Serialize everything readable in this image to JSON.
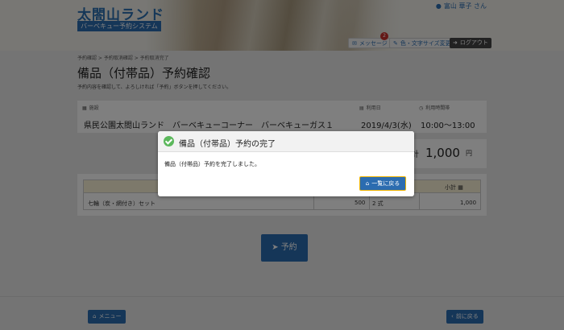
{
  "header": {
    "site_title": "太閤山ランド",
    "site_subtitle": "バーベキュー予約システム",
    "user_name": "富山 華子 さん",
    "message_label": "メッセージ",
    "message_badge": "2",
    "color_label": "色・文字サイズ変更",
    "logout_label": "ログアウト"
  },
  "breadcrumb": "予約確認 > 予約取消確認 > 予約取消完了",
  "page": {
    "title": "備品（付帯品）予約確認",
    "description": "予約内容を確認して、よろしければ「予約」ボタンを押してください。"
  },
  "info": {
    "facility_label": "施設",
    "facility_value": "県民公園太閤山ランド　バーベキューコーナー　バーベキューガス１",
    "date_label": "利用日",
    "date_value": "2019/4/3(水)",
    "time_label": "利用時間帯",
    "time_value": "10:00～13:00"
  },
  "total": {
    "prefix": "計",
    "amount": "1,000",
    "unit": "円"
  },
  "table": {
    "subtotal_header": "小計",
    "rows": [
      {
        "item": "七輪（炭・網付き）セット",
        "price": "500",
        "qty": "2 式",
        "subtotal": "1,000"
      }
    ]
  },
  "reserve_label": "予約",
  "footer": {
    "menu_label": "メニュー",
    "back_label": "前に戻る"
  },
  "modal": {
    "title": "備品（付帯品）予約の完了",
    "message": "備品（付帯品）予約を完了しました。",
    "button_label": "一覧に戻る"
  }
}
